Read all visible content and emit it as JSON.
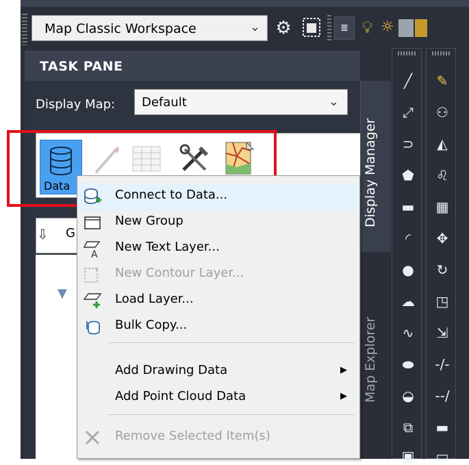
{
  "toolbar": {
    "workspace_value": "Map Classic Workspace",
    "gear_icon": "gear-icon"
  },
  "task_pane": {
    "title": "TASK PANE",
    "display_map_label": "Display Map:",
    "display_map_value": "Default",
    "data_button_label": "Data",
    "group_letter": "G",
    "tabs": {
      "display_manager": "Display Manager",
      "map_explorer": "Map Explorer"
    }
  },
  "context_menu": {
    "items": [
      {
        "label": "Connect to Data...",
        "icon": "connect-data-icon",
        "enabled": true
      },
      {
        "label": "New Group",
        "icon": "folder-icon",
        "enabled": true
      },
      {
        "label": "New Text Layer...",
        "icon": "text-layer-icon",
        "enabled": true
      },
      {
        "label": "New Contour Layer...",
        "icon": "contour-layer-icon",
        "enabled": false
      },
      {
        "label": "Load Layer...",
        "icon": "load-layer-icon",
        "enabled": true
      },
      {
        "label": "Bulk Copy...",
        "icon": "bulk-copy-icon",
        "enabled": true
      },
      {
        "label": "Add Drawing Data",
        "submenu": true,
        "enabled": true
      },
      {
        "label": "Add Point Cloud Data",
        "submenu": true,
        "enabled": true
      },
      {
        "label": "Remove Selected Item(s)",
        "icon": "remove-icon",
        "enabled": false
      }
    ]
  },
  "colors": {
    "highlight": "#e3101a",
    "frame": "#2b2f3a",
    "data_button": "#4aa0f0"
  }
}
